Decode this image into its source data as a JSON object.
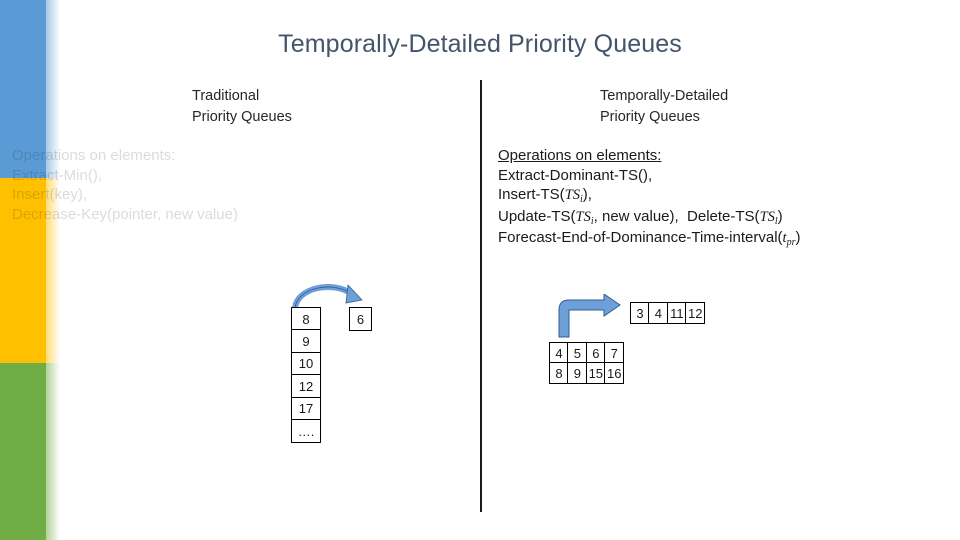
{
  "slide": {
    "title": "Temporally-Detailed Priority Queues"
  },
  "columns": {
    "left": {
      "header": "Traditional\nPriority Queues",
      "ghost_operations": {
        "heading": "Operations on elements:",
        "lines": [
          "Extract-Min(),",
          "Insert(key),",
          "Decrease-Key(pointer, new value)"
        ],
        "full_text": "Operations on elements:\nExtract-Min(),\nInsert(key),\nDecrease-Key(pointer, new value)"
      },
      "queue": {
        "cells": [
          "8",
          "9",
          "10",
          "12",
          "17",
          "…."
        ],
        "extracted_cell": "6"
      },
      "arrow": "curved-extract-arrow"
    },
    "right": {
      "header": "Temporally-Detailed\nPriority Queues",
      "operations": {
        "heading": "Operations on elements:",
        "line1": "Extract-Dominant-TS(),",
        "line2_prefix": "Insert-TS(",
        "line2_arg": "TS",
        "line2_sub": "i",
        "line2_suffix": "),",
        "line3_a_prefix": "Update-TS(",
        "line3_a_arg": "TS",
        "line3_a_sub": "i",
        "line3_a_mid": ", new value),",
        "line3_b_prefix": "Delete-TS(",
        "line3_b_arg": "TS",
        "line3_b_sub": "l",
        "line3_b_suffix": ")",
        "line4_prefix": "Forecast-End-of-Dominance-Time-interval(",
        "line4_arg": "t",
        "line4_sub": "pr",
        "line4_suffix": ")"
      },
      "top_row": {
        "cells": [
          "3",
          "4",
          "11",
          "12"
        ]
      },
      "grid": {
        "rows": [
          [
            "4",
            "5",
            "6",
            "7"
          ],
          [
            "8",
            "9",
            "15",
            "16"
          ]
        ]
      },
      "arrow": "elbow-extract-arrow"
    }
  },
  "theme": {
    "title_color": "#44546a",
    "band_blue": "#5b9bd5",
    "band_amber": "#ffc000",
    "band_green": "#70ad47",
    "arrow_fill": "#6f9fd8",
    "arrow_stroke": "#2e5e96",
    "text_color": "#1a1a1a",
    "box_border": "#000000"
  }
}
